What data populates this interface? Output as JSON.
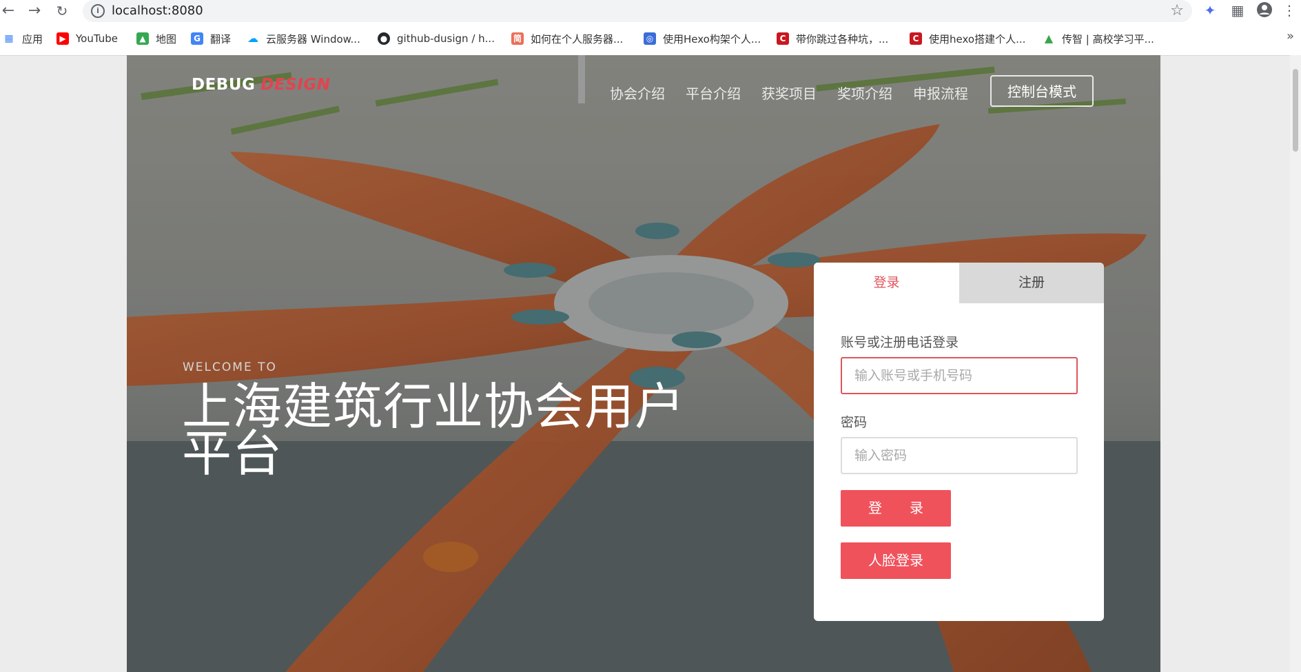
{
  "browser": {
    "url": "localhost:8080",
    "nav_icons": [
      "back-arrow-icon",
      "forward-arrow-icon",
      "reload-icon"
    ],
    "bookmarks": [
      {
        "label": "应用",
        "icon": "apps-grid-icon",
        "color": "#4285f4"
      },
      {
        "label": "YouTube",
        "icon": "youtube-icon",
        "color": "#ff0000"
      },
      {
        "label": "地图",
        "icon": "maps-icon",
        "color": "#34a853"
      },
      {
        "label": "翻译",
        "icon": "translate-icon",
        "color": "#4285f4"
      },
      {
        "label": "云服务器 Window...",
        "icon": "cloud-icon",
        "color": "#00a4ff"
      },
      {
        "label": "github-dusign / h...",
        "icon": "github-icon",
        "color": "#24292e"
      },
      {
        "label": "如何在个人服务器...",
        "icon": "jianshu-icon",
        "color": "#ea6f5a"
      },
      {
        "label": "使用Hexo构架个人...",
        "icon": "site-icon",
        "color": "#3b6dd8"
      },
      {
        "label": "带你跳过各种坑，...",
        "icon": "csdn-icon",
        "color": "#c9171e"
      },
      {
        "label": "使用hexo搭建个人...",
        "icon": "csdn-icon",
        "color": "#c9171e"
      },
      {
        "label": "传智 | 高校学习平...",
        "icon": "graduation-cap-icon",
        "color": "#3aa64a"
      }
    ]
  },
  "site": {
    "brand_part1": "DEBUG",
    "brand_part2": "DESIGN",
    "nav": [
      "协会介绍",
      "平台介绍",
      "获奖项目",
      "奖项介绍",
      "申报流程"
    ],
    "console_button": "控制台模式",
    "welcome": "WELCOME TO",
    "title": "上海建筑行业协会用户平台"
  },
  "login": {
    "tabs": {
      "login": "登录",
      "register": "注册"
    },
    "account_label": "账号或注册电话登录",
    "account_placeholder": "输入账号或手机号码",
    "password_label": "密码",
    "password_placeholder": "输入密码",
    "login_button": "登　　录",
    "face_login_button": "人脸登录"
  },
  "colors": {
    "accent": "#f0525c",
    "tab_active": "#e0545d",
    "brand_red": "#e0454f"
  }
}
